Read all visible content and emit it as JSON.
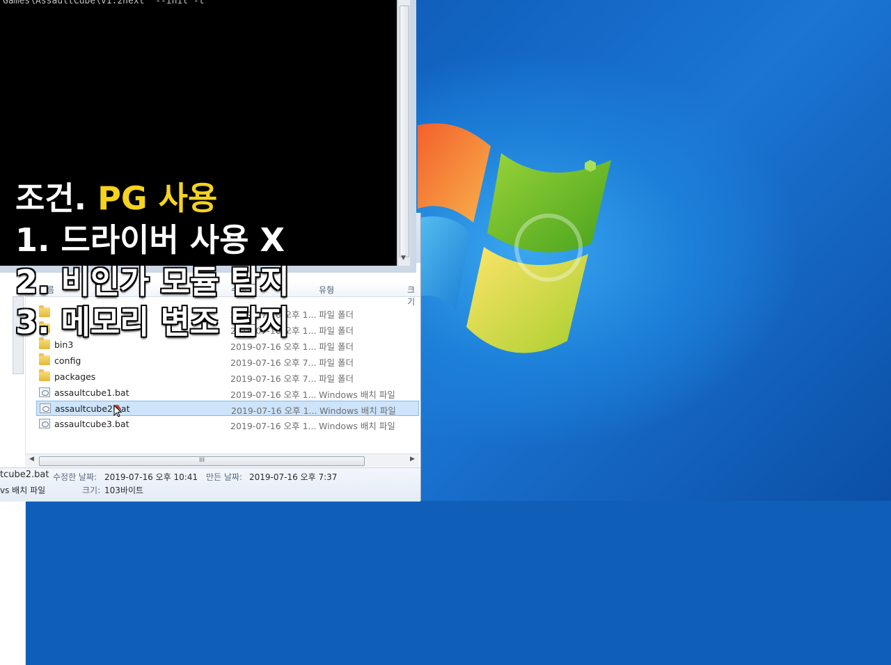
{
  "console": {
    "command_line": "Games\\AssaultCube\\v1.2next  --init -t"
  },
  "overlay": {
    "line1_prefix": "조건.",
    "line1_highlight": "PG 사용",
    "line2": "1. 드라이버 사용 X",
    "line3": "2. 비인가 모듈 탐지",
    "line4": "3. 메모리 변조 탐지"
  },
  "explorer": {
    "columns": {
      "name": "이름",
      "date": "수정",
      "type": "유형",
      "size": "크기"
    },
    "rows": [
      {
        "name": "",
        "date": "2019-07-16 오후 1...",
        "type": "파일 폴더",
        "icon": "folder-icon"
      },
      {
        "name": "",
        "date": "2019-07-16 오후 1...",
        "type": "파일 폴더",
        "icon": "folder-icon"
      },
      {
        "name": "bin3",
        "date": "2019-07-16 오후 1...",
        "type": "파일 폴더",
        "icon": "folder-icon"
      },
      {
        "name": "config",
        "date": "2019-07-16 오후 7...",
        "type": "파일 폴더",
        "icon": "folder-icon"
      },
      {
        "name": "packages",
        "date": "2019-07-16 오후 7...",
        "type": "파일 폴더",
        "icon": "folder-icon"
      },
      {
        "name": "assaultcube1.bat",
        "date": "2019-07-16 오후 1...",
        "type": "Windows 배치 파일",
        "icon": "batch-file-icon"
      },
      {
        "name": "assaultcube2.bat",
        "date": "2019-07-16 오후 1...",
        "type": "Windows 배치 파일",
        "icon": "batch-file-icon",
        "selected": true
      },
      {
        "name": "assaultcube3.bat",
        "date": "2019-07-16 오후 1...",
        "type": "Windows 배치 파일",
        "icon": "batch-file-icon"
      }
    ],
    "hscroll_grip": "III",
    "details": {
      "filename": "tcube2.bat",
      "modified_label": "수정한 날짜:",
      "modified_value": "2019-07-16 오후 10:41",
      "created_label": "만든 날짜:",
      "created_value": "2019-07-16 오후 7:37",
      "type_value": "vs 배치 파일",
      "size_label": "크기:",
      "size_value": "103바이트"
    }
  },
  "colors": {
    "highlight": "#f5d31e",
    "selection": "#cde4fb",
    "console_bg": "#000000"
  }
}
